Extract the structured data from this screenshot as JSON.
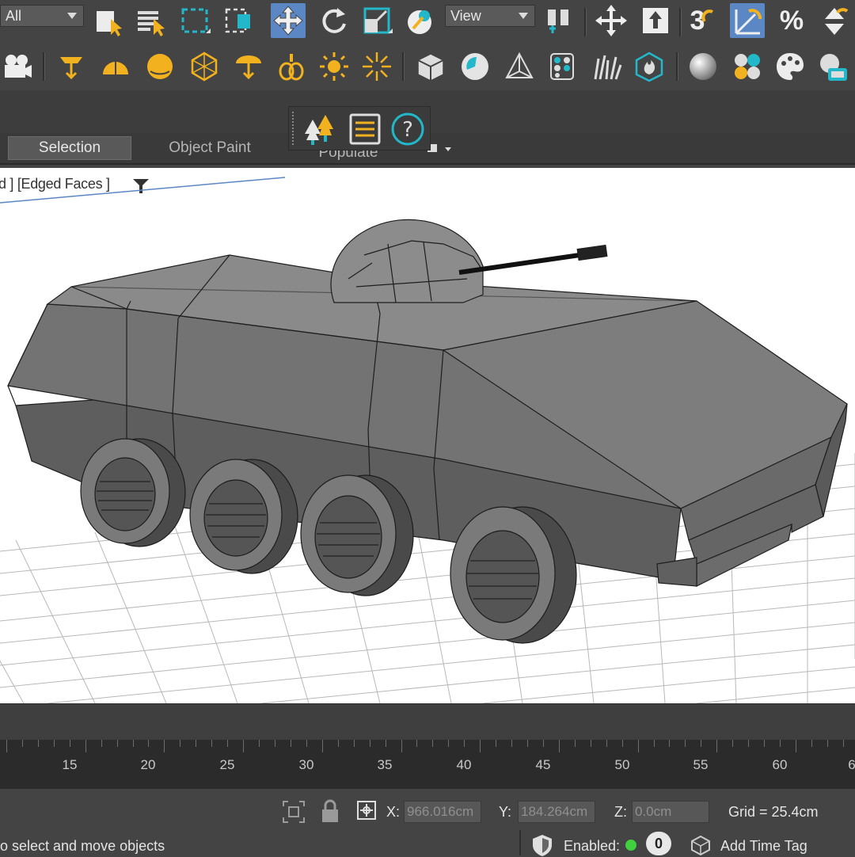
{
  "toolbar": {
    "selection_filter": "All",
    "reference_coord": "View",
    "snap_angle_label": "3",
    "percent_snap_label": "%"
  },
  "ribbon": {
    "tabs": [
      {
        "label": "Selection",
        "active": true
      },
      {
        "label": "Object Paint",
        "active": false
      },
      {
        "label": "Populate",
        "active": false
      }
    ]
  },
  "viewport": {
    "label": "d ] [Edged Faces ]"
  },
  "timeline": {
    "frames": [
      "15",
      "20",
      "25",
      "30",
      "35",
      "40",
      "45",
      "50",
      "55",
      "60",
      "6"
    ]
  },
  "status": {
    "prompt": "o select and move objects",
    "x_label": "X:",
    "x_value": "966.016cm",
    "y_label": "Y:",
    "y_value": "184.264cm",
    "z_label": "Z:",
    "z_value": "0.0cm",
    "grid": "Grid = 25.4cm",
    "enabled_label": "Enabled:",
    "enabled_count": "0",
    "add_time_tag": "Add Time Tag"
  },
  "colors": {
    "ui_bg": "#444444",
    "accent_blue": "#5b87c5",
    "icon_yellow": "#f2b21f",
    "icon_cyan": "#22b8c9",
    "model_gray": "#767676",
    "enabled_green": "#3fd13f"
  }
}
